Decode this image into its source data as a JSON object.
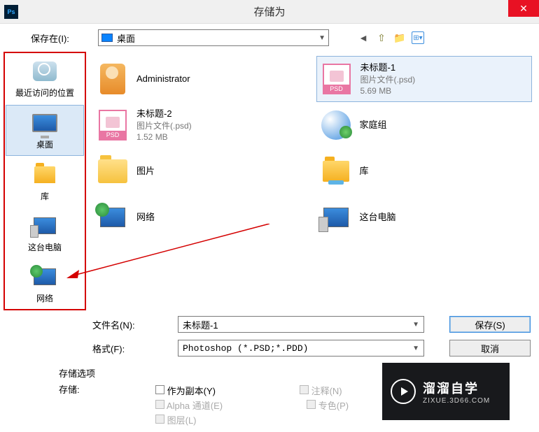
{
  "titlebar": {
    "title": "存储为",
    "app_icon": "Ps"
  },
  "savein": {
    "label": "保存在(I):",
    "value": "桌面",
    "toolbar": [
      "back-icon",
      "up-icon",
      "newfolder-icon",
      "view-icon"
    ]
  },
  "places": [
    {
      "id": "recent",
      "label": "最近访问的位置"
    },
    {
      "id": "desktop",
      "label": "桌面",
      "selected": true
    },
    {
      "id": "libraries",
      "label": "库"
    },
    {
      "id": "thispc",
      "label": "这台电脑"
    },
    {
      "id": "network",
      "label": "网络"
    }
  ],
  "files": [
    {
      "icon": "user",
      "name": "Administrator"
    },
    {
      "icon": "psd",
      "name": "未标题-1",
      "sub1": "图片文件(.psd)",
      "sub2": "5.69 MB",
      "selected": true
    },
    {
      "icon": "psd",
      "name": "未标题-2",
      "sub1": "图片文件(.psd)",
      "sub2": "1.52 MB"
    },
    {
      "icon": "group",
      "name": "家庭组"
    },
    {
      "icon": "picfolder",
      "name": "图片"
    },
    {
      "icon": "lib",
      "name": "库"
    },
    {
      "icon": "net",
      "name": "网络"
    },
    {
      "icon": "pc",
      "name": "这台电脑"
    }
  ],
  "filename": {
    "label": "文件名(N):",
    "value": "未标题-1"
  },
  "format": {
    "label": "格式(F):",
    "value": "Photoshop (*.PSD;*.PDD)"
  },
  "buttons": {
    "save": "保存(S)",
    "cancel": "取消"
  },
  "options": {
    "header": "存储选项",
    "store": "存储:",
    "copy": "作为副本(Y)",
    "note": "注释(N)",
    "alpha": "Alpha 通道(E)",
    "spot": "专色(P)",
    "layers": "图层(L)"
  },
  "watermark": {
    "title": "溜溜自学",
    "url": "ZIXUE.3D66.COM"
  }
}
